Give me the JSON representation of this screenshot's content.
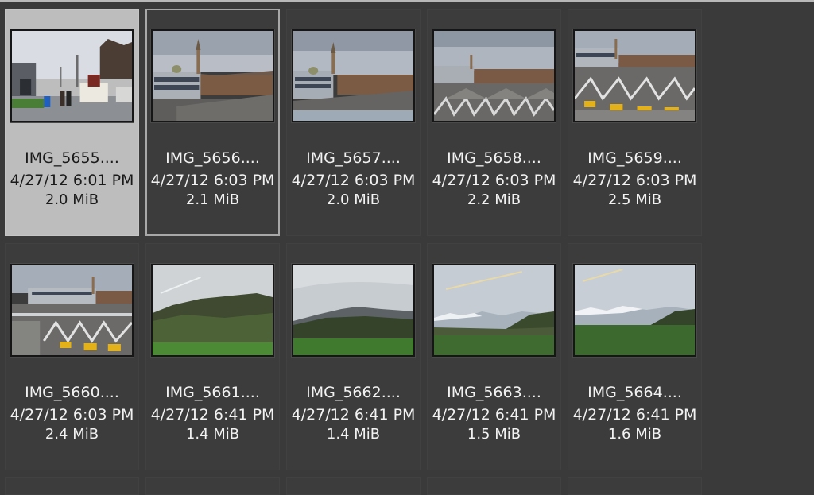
{
  "thumbnails": [
    {
      "name": "IMG_5655....",
      "date": "4/27/12 6:01 PM",
      "size": "2.0 MiB",
      "scene": "street-icon",
      "selected": true,
      "focused": false
    },
    {
      "name": "IMG_5656....",
      "date": "4/27/12 6:03 PM",
      "size": "2.1 MiB",
      "scene": "city-rooftop-icon",
      "selected": false,
      "focused": true
    },
    {
      "name": "IMG_5657....",
      "date": "4/27/12 6:03 PM",
      "size": "2.0 MiB",
      "scene": "city-rooftop-icon",
      "selected": false,
      "focused": false
    },
    {
      "name": "IMG_5658....",
      "date": "4/27/12 6:03 PM",
      "size": "2.2 MiB",
      "scene": "sawtooth-roof-icon",
      "selected": false,
      "focused": false
    },
    {
      "name": "IMG_5659....",
      "date": "4/27/12 6:03 PM",
      "size": "2.5 MiB",
      "scene": "bus-depot-icon",
      "selected": false,
      "focused": false
    },
    {
      "name": "IMG_5660....",
      "date": "4/27/12 6:03 PM",
      "size": "2.4 MiB",
      "scene": "bus-depot-icon",
      "selected": false,
      "focused": false
    },
    {
      "name": "IMG_5661....",
      "date": "4/27/12 6:41 PM",
      "size": "1.4 MiB",
      "scene": "green-hills-icon",
      "selected": false,
      "focused": false
    },
    {
      "name": "IMG_5662....",
      "date": "4/27/12 6:41 PM",
      "size": "1.4 MiB",
      "scene": "green-hills-icon",
      "selected": false,
      "focused": false
    },
    {
      "name": "IMG_5663....",
      "date": "4/27/12 6:41 PM",
      "size": "1.5 MiB",
      "scene": "snowy-mountains-icon",
      "selected": false,
      "focused": false
    },
    {
      "name": "IMG_5664....",
      "date": "4/27/12 6:41 PM",
      "size": "1.6 MiB",
      "scene": "snowy-mountains-icon",
      "selected": false,
      "focused": false
    }
  ],
  "colors": {
    "background": "#3a3a3a",
    "selected": "#bdbdbd",
    "focus_border": "#a8a8a8",
    "text": "#f2f2f2"
  }
}
